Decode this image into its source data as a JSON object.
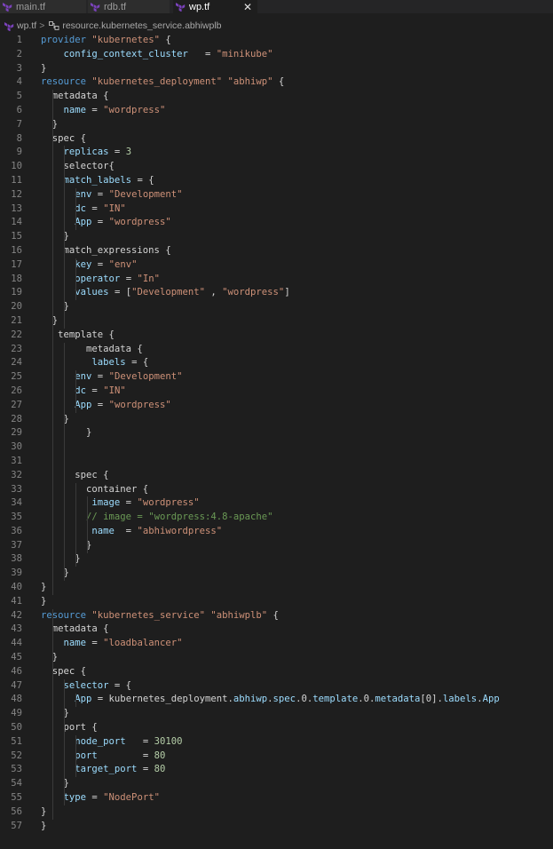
{
  "tabs": [
    {
      "label": "main.tf",
      "active": false
    },
    {
      "label": "rdb.tf",
      "active": false
    },
    {
      "label": "wp.tf",
      "active": true,
      "close_glyph": "✕"
    }
  ],
  "breadcrumb": {
    "file": "wp.tf",
    "separator": ">",
    "symbol": "resource.kubernetes_service.abhiwplb"
  },
  "colors": {
    "keyword": "#569cd6",
    "string": "#ce9178",
    "property": "#9cdcfe",
    "number": "#b5cea8",
    "comment": "#6a9955",
    "text": "#d4d4d4",
    "line_number": "#858585",
    "terraform_icon": "#7b42bc"
  },
  "editor": {
    "lines": [
      {
        "n": "1",
        "code": [
          [
            "k",
            "provider"
          ],
          [
            "t",
            " "
          ],
          [
            "s",
            "\"kubernetes\""
          ],
          [
            "t",
            " {"
          ]
        ]
      },
      {
        "n": "2",
        "code": [
          [
            "t",
            "    "
          ],
          [
            "p",
            "config_context_cluster"
          ],
          [
            "t",
            "   = "
          ],
          [
            "s",
            "\"minikube\""
          ]
        ]
      },
      {
        "n": "3",
        "code": [
          [
            "t",
            "}"
          ]
        ]
      },
      {
        "n": "4",
        "code": [
          [
            "k",
            "resource"
          ],
          [
            "t",
            " "
          ],
          [
            "s",
            "\"kubernetes_deployment\""
          ],
          [
            "t",
            " "
          ],
          [
            "s",
            "\"abhiwp\""
          ],
          [
            "t",
            " {"
          ]
        ]
      },
      {
        "n": "5",
        "code": [
          [
            "t",
            "  metadata {"
          ]
        ]
      },
      {
        "n": "6",
        "code": [
          [
            "t",
            "    "
          ],
          [
            "p",
            "name"
          ],
          [
            "t",
            " = "
          ],
          [
            "s",
            "\"wordpress\""
          ]
        ]
      },
      {
        "n": "7",
        "code": [
          [
            "t",
            "  }"
          ]
        ]
      },
      {
        "n": "8",
        "code": [
          [
            "t",
            "  spec {"
          ]
        ]
      },
      {
        "n": "9",
        "code": [
          [
            "t",
            "    "
          ],
          [
            "p",
            "replicas"
          ],
          [
            "t",
            " = "
          ],
          [
            "n",
            "3"
          ]
        ]
      },
      {
        "n": "10",
        "code": [
          [
            "t",
            "    selector{"
          ]
        ]
      },
      {
        "n": "11",
        "code": [
          [
            "t",
            "    "
          ],
          [
            "p",
            "match_labels"
          ],
          [
            "t",
            " = {"
          ]
        ]
      },
      {
        "n": "12",
        "code": [
          [
            "t",
            "      "
          ],
          [
            "p",
            "env"
          ],
          [
            "t",
            " = "
          ],
          [
            "s",
            "\"Development\""
          ]
        ]
      },
      {
        "n": "13",
        "code": [
          [
            "t",
            "      "
          ],
          [
            "p",
            "dc"
          ],
          [
            "t",
            " = "
          ],
          [
            "s",
            "\"IN\""
          ]
        ]
      },
      {
        "n": "14",
        "code": [
          [
            "t",
            "      "
          ],
          [
            "p",
            "App"
          ],
          [
            "t",
            " = "
          ],
          [
            "s",
            "\"wordpress\""
          ]
        ]
      },
      {
        "n": "15",
        "code": [
          [
            "t",
            "    }"
          ]
        ]
      },
      {
        "n": "16",
        "code": [
          [
            "t",
            "    match_expressions {"
          ]
        ]
      },
      {
        "n": "17",
        "code": [
          [
            "t",
            "      "
          ],
          [
            "p",
            "key"
          ],
          [
            "t",
            " = "
          ],
          [
            "s",
            "\"env\""
          ]
        ]
      },
      {
        "n": "18",
        "code": [
          [
            "t",
            "      "
          ],
          [
            "p",
            "operator"
          ],
          [
            "t",
            " = "
          ],
          [
            "s",
            "\"In\""
          ]
        ]
      },
      {
        "n": "19",
        "code": [
          [
            "t",
            "      "
          ],
          [
            "p",
            "values"
          ],
          [
            "t",
            " = ["
          ],
          [
            "s",
            "\"Development\""
          ],
          [
            "t",
            " , "
          ],
          [
            "s",
            "\"wordpress\""
          ],
          [
            "t",
            "]"
          ]
        ]
      },
      {
        "n": "20",
        "code": [
          [
            "t",
            "    }"
          ]
        ]
      },
      {
        "n": "21",
        "code": [
          [
            "t",
            "  }"
          ]
        ]
      },
      {
        "n": "22",
        "code": [
          [
            "t",
            "   template {"
          ]
        ]
      },
      {
        "n": "23",
        "code": [
          [
            "t",
            "        metadata {"
          ]
        ]
      },
      {
        "n": "24",
        "code": [
          [
            "t",
            "         "
          ],
          [
            "p",
            "labels"
          ],
          [
            "t",
            " = {"
          ]
        ]
      },
      {
        "n": "25",
        "code": [
          [
            "t",
            "      "
          ],
          [
            "p",
            "env"
          ],
          [
            "t",
            " = "
          ],
          [
            "s",
            "\"Development\""
          ]
        ]
      },
      {
        "n": "26",
        "code": [
          [
            "t",
            "      "
          ],
          [
            "p",
            "dc"
          ],
          [
            "t",
            " = "
          ],
          [
            "s",
            "\"IN\""
          ]
        ]
      },
      {
        "n": "27",
        "code": [
          [
            "t",
            "      "
          ],
          [
            "p",
            "App"
          ],
          [
            "t",
            " = "
          ],
          [
            "s",
            "\"wordpress\""
          ]
        ]
      },
      {
        "n": "28",
        "code": [
          [
            "t",
            "    }"
          ]
        ]
      },
      {
        "n": "29",
        "code": [
          [
            "t",
            "        }"
          ]
        ]
      },
      {
        "n": "30",
        "code": []
      },
      {
        "n": "31",
        "code": []
      },
      {
        "n": "32",
        "code": [
          [
            "t",
            "      spec {"
          ]
        ]
      },
      {
        "n": "33",
        "code": [
          [
            "t",
            "        container {"
          ]
        ]
      },
      {
        "n": "34",
        "code": [
          [
            "t",
            "         "
          ],
          [
            "p",
            "image"
          ],
          [
            "t",
            " = "
          ],
          [
            "s",
            "\"wordpress\""
          ]
        ]
      },
      {
        "n": "35",
        "code": [
          [
            "t",
            "        "
          ],
          [
            "c",
            "// image = \"wordpress:4.8-apache\""
          ]
        ]
      },
      {
        "n": "36",
        "code": [
          [
            "t",
            "         "
          ],
          [
            "p",
            "name"
          ],
          [
            "t",
            "  = "
          ],
          [
            "s",
            "\"abhiwordpress\""
          ]
        ]
      },
      {
        "n": "37",
        "code": [
          [
            "t",
            "        }"
          ]
        ]
      },
      {
        "n": "38",
        "code": [
          [
            "t",
            "      }"
          ]
        ]
      },
      {
        "n": "39",
        "code": [
          [
            "t",
            "    }"
          ]
        ]
      },
      {
        "n": "40",
        "code": [
          [
            "t",
            "}"
          ]
        ]
      },
      {
        "n": "41",
        "code": [
          [
            "t",
            "}"
          ]
        ]
      },
      {
        "n": "42",
        "code": [
          [
            "k",
            "resource"
          ],
          [
            "t",
            " "
          ],
          [
            "s",
            "\"kubernetes_service\""
          ],
          [
            "t",
            " "
          ],
          [
            "s",
            "\"abhiwplb\""
          ],
          [
            "t",
            " {"
          ]
        ]
      },
      {
        "n": "43",
        "code": [
          [
            "t",
            "  metadata {"
          ]
        ]
      },
      {
        "n": "44",
        "code": [
          [
            "t",
            "    "
          ],
          [
            "p",
            "name"
          ],
          [
            "t",
            " = "
          ],
          [
            "s",
            "\"loadbalancer\""
          ]
        ]
      },
      {
        "n": "45",
        "code": [
          [
            "t",
            "  }"
          ]
        ]
      },
      {
        "n": "46",
        "code": [
          [
            "t",
            "  spec {"
          ]
        ]
      },
      {
        "n": "47",
        "code": [
          [
            "t",
            "    "
          ],
          [
            "p",
            "selector"
          ],
          [
            "t",
            " = {"
          ]
        ]
      },
      {
        "n": "48",
        "code": [
          [
            "t",
            "      "
          ],
          [
            "p",
            "App"
          ],
          [
            "t",
            " = kubernetes_deployment."
          ],
          [
            "p",
            "abhiwp"
          ],
          [
            "t",
            "."
          ],
          [
            "p",
            "spec"
          ],
          [
            "t",
            ".0."
          ],
          [
            "p",
            "template"
          ],
          [
            "t",
            ".0."
          ],
          [
            "p",
            "metadata"
          ],
          [
            "t",
            "[0]."
          ],
          [
            "p",
            "labels"
          ],
          [
            "t",
            "."
          ],
          [
            "p",
            "App"
          ]
        ]
      },
      {
        "n": "49",
        "code": [
          [
            "t",
            "    }"
          ]
        ]
      },
      {
        "n": "50",
        "code": [
          [
            "t",
            "    port {"
          ]
        ]
      },
      {
        "n": "51",
        "code": [
          [
            "t",
            "      "
          ],
          [
            "p",
            "node_port"
          ],
          [
            "t",
            "   = "
          ],
          [
            "n",
            "30100"
          ]
        ]
      },
      {
        "n": "52",
        "code": [
          [
            "t",
            "      "
          ],
          [
            "p",
            "port"
          ],
          [
            "t",
            "        = "
          ],
          [
            "n",
            "80"
          ]
        ]
      },
      {
        "n": "53",
        "code": [
          [
            "t",
            "      "
          ],
          [
            "p",
            "target_port"
          ],
          [
            "t",
            " = "
          ],
          [
            "n",
            "80"
          ]
        ]
      },
      {
        "n": "54",
        "code": [
          [
            "t",
            "    }"
          ]
        ]
      },
      {
        "n": "55",
        "code": [
          [
            "t",
            "    "
          ],
          [
            "p",
            "type"
          ],
          [
            "t",
            " = "
          ],
          [
            "s",
            "\"NodePort\""
          ]
        ]
      },
      {
        "n": "56",
        "code": [
          [
            "t",
            "}"
          ]
        ]
      },
      {
        "n": "57",
        "code": [
          [
            "t",
            "}"
          ]
        ]
      }
    ]
  }
}
